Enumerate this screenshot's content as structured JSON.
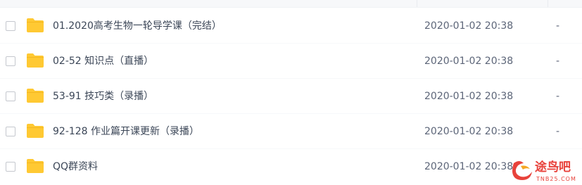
{
  "files": [
    {
      "name": "01.2020高考生物一轮导学课（完结）",
      "modified": "2020-01-02 20:38",
      "size": "-",
      "icon": "folder-icon"
    },
    {
      "name": "02-52  知识点（直播）",
      "modified": "2020-01-02 20:38",
      "size": "-",
      "icon": "folder-icon"
    },
    {
      "name": "53-91 技巧类（录播）",
      "modified": "2020-01-02 20:38",
      "size": "-",
      "icon": "folder-icon"
    },
    {
      "name": "92-128 作业篇开课更新（录播）",
      "modified": "2020-01-02 20:38",
      "size": "-",
      "icon": "folder-icon"
    },
    {
      "name": "QQ群资料",
      "modified": "2020-01-02 20:38",
      "size": "-",
      "icon": "folder-icon"
    }
  ],
  "watermark": {
    "text": "途鸟吧",
    "url": "TNB25.COM"
  },
  "colors": {
    "folder": "#ffc933",
    "watermark": "#e8423b"
  }
}
